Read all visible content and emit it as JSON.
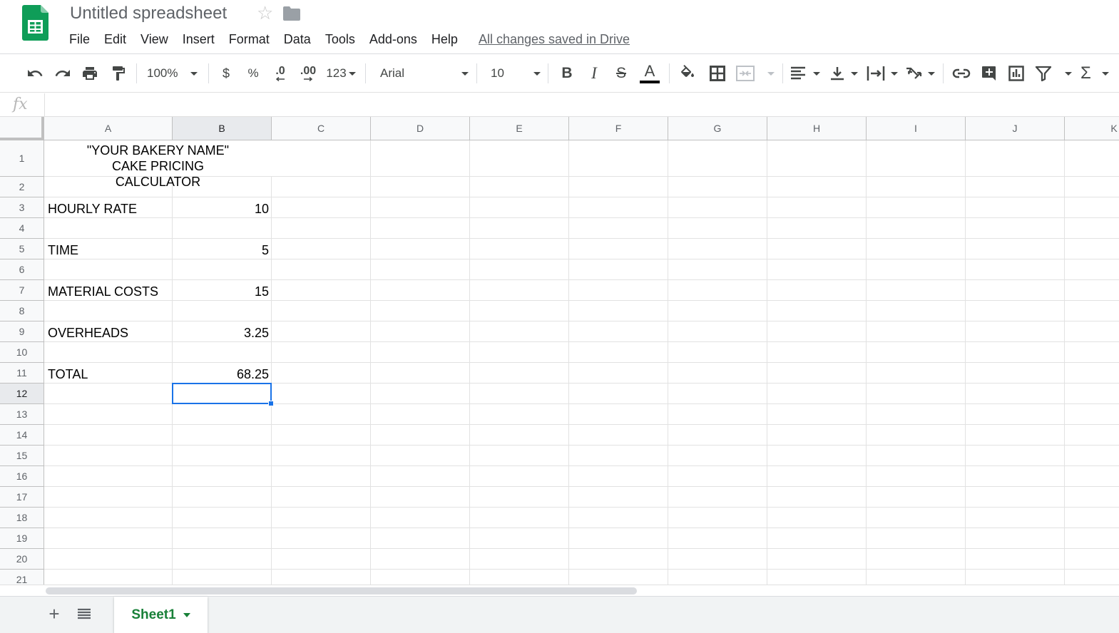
{
  "app": {
    "doc_title": "Untitled spreadsheet",
    "saved_status": "All changes saved in Drive",
    "brand_color": "#0f9d58",
    "accent_color": "#1a73e8"
  },
  "menu": {
    "items": [
      "File",
      "Edit",
      "View",
      "Insert",
      "Format",
      "Data",
      "Tools",
      "Add-ons",
      "Help"
    ]
  },
  "toolbar": {
    "zoom": "100%",
    "currency": "$",
    "percent": "%",
    "decrease_decimal": ".0",
    "increase_decimal": ".00",
    "more_formats": "123",
    "font_family": "Arial",
    "font_size": "10",
    "icons": [
      "undo-icon",
      "redo-icon",
      "print-icon",
      "paint-format-icon",
      "bold-icon",
      "italic-icon",
      "strikethrough-icon",
      "text-color-icon",
      "fill-color-icon",
      "borders-icon",
      "merge-cells-icon",
      "horizontal-align-icon",
      "vertical-align-icon",
      "text-wrap-icon",
      "text-rotation-icon",
      "insert-link-icon",
      "insert-comment-icon",
      "insert-chart-icon",
      "filter-icon",
      "functions-icon"
    ]
  },
  "formula_bar": {
    "fx": "fx",
    "value": ""
  },
  "grid": {
    "columns": [
      "A",
      "B",
      "C",
      "D",
      "E",
      "F",
      "G",
      "H",
      "I",
      "J",
      "K"
    ],
    "rows": [
      "1",
      "2",
      "3",
      "4",
      "5",
      "6",
      "7",
      "8",
      "9",
      "10",
      "11",
      "12",
      "13",
      "14",
      "15",
      "16",
      "17",
      "18",
      "19",
      "20",
      "21"
    ],
    "selected_cell": "B12",
    "cells": {
      "title": "\"YOUR BAKERY NAME\" CAKE PRICING CALCULATOR",
      "a3": "HOURLY RATE",
      "b3": "10",
      "a5": "TIME",
      "b5": "5",
      "a7": "MATERIAL COSTS",
      "b7": "15",
      "a9": "OVERHEADS",
      "b9": "3.25",
      "a11": "TOTAL",
      "b11": "68.25"
    }
  },
  "sheets": {
    "add_label": "+",
    "tabs": [
      "Sheet1"
    ]
  }
}
